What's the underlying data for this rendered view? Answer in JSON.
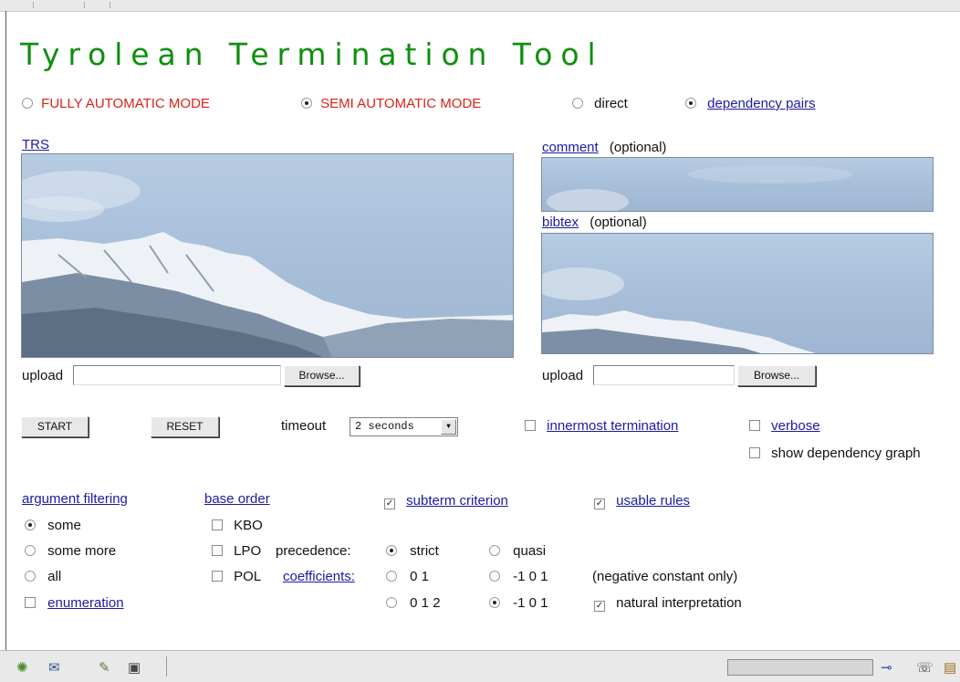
{
  "title": "Tyrolean Termination Tool",
  "modes": {
    "fully": "FULLY AUTOMATIC MODE",
    "semi": "SEMI AUTOMATIC MODE",
    "direct": "direct",
    "dp": "dependency pairs"
  },
  "trs": {
    "label": "TRS"
  },
  "comment": {
    "label": "comment",
    "optional": "(optional)"
  },
  "bibtex": {
    "label": "bibtex",
    "optional": "(optional)"
  },
  "upload": {
    "label": "upload",
    "browse": "Browse..."
  },
  "actions": {
    "start": "START",
    "reset": "RESET",
    "timeout_label": "timeout",
    "timeout_value": "2 seconds"
  },
  "options": {
    "innermost": "innermost termination",
    "verbose": "verbose",
    "show_graph": "show dependency graph"
  },
  "argument_filtering": {
    "header": "argument filtering",
    "some": "some",
    "some_more": "some more",
    "all": "all",
    "enumeration": "enumeration"
  },
  "base_order": {
    "header": "base order",
    "kbo": "KBO",
    "lpo": "LPO",
    "pol": "POL",
    "precedence": "precedence:",
    "coefficients": "coefficients:"
  },
  "subterm": "subterm criterion",
  "usable": "usable rules",
  "precedence_opts": {
    "strict": "strict",
    "quasi": "quasi"
  },
  "coeff_opts": {
    "c01": "0 1",
    "cm101a": "-1 0 1",
    "c012": "0 1 2",
    "cm101b": "-1 0 1",
    "neg_const": "(negative constant only)",
    "natural": "natural interpretation"
  },
  "colors": {
    "title": "#0e8f0e",
    "mode": "#e0201a",
    "link": "#1a1aa6"
  },
  "status_icons": [
    "bug-icon",
    "mail-icon",
    "edit-icon",
    "addressbook-icon",
    "connection-icon",
    "security-icon",
    "lock-icon"
  ]
}
